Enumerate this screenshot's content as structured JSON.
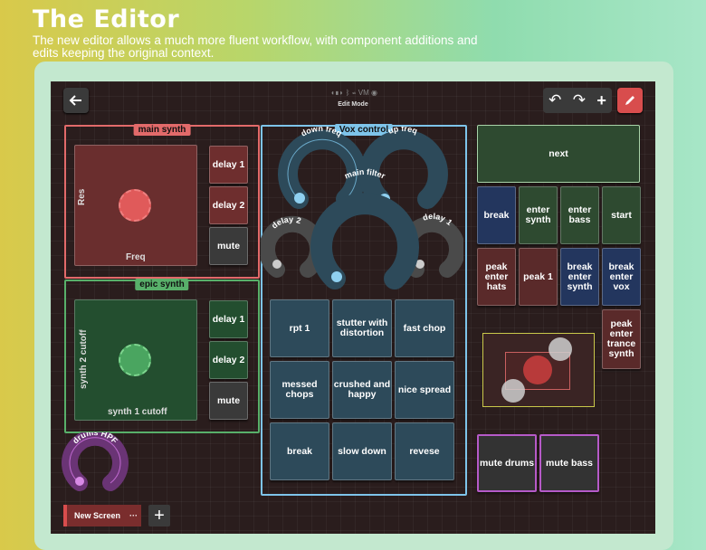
{
  "hero": {
    "title": "The Editor",
    "subtitle": "The new editor allows a much more fluent workflow, with component additions and edits keeping the original context."
  },
  "toolbar": {
    "back_icon": "arrow-left-icon",
    "status_icons": [
      "audio-icon",
      "bluetooth-icon",
      "usb-icon",
      "vm-icon",
      "settings-icon"
    ],
    "status_text": "VM",
    "mode_label": "Edit Mode",
    "undo_icon": "undo-icon",
    "redo_icon": "redo-icon",
    "add_icon": "plus-icon",
    "edit_icon": "pencil-icon"
  },
  "groups": {
    "main_synth": {
      "label": "main synth",
      "color": "#e26a6a",
      "xy": {
        "y_label": "Res",
        "x_label": "Freq"
      },
      "buttons": [
        "delay 1",
        "delay 2",
        "mute"
      ]
    },
    "epic_synth": {
      "label": "epic synth",
      "color": "#58b06a",
      "xy": {
        "y_label": "synth 2 cutoff",
        "x_label": "synth 1 cutoff"
      },
      "buttons": [
        "delay 1",
        "delay 2",
        "mute"
      ]
    },
    "vox_control": {
      "label": "Vox control",
      "color": "#7ec4ea",
      "knobs": {
        "down_freq": "down freq",
        "up_freq": "up freq",
        "main_filter": "main filter",
        "delay_2": "delay 2",
        "delay_1": "delay 1"
      },
      "pads": [
        "rpt 1",
        "stutter with distortion",
        "fast chop",
        "messed chops",
        "crushed and happy",
        "nice spread",
        "break",
        "slow down",
        "revese"
      ]
    }
  },
  "right": {
    "next": "next",
    "row1": [
      "break",
      "enter synth",
      "enter bass",
      "start"
    ],
    "row2": [
      "peak enter hats",
      "peak 1",
      "break enter synth",
      "break enter vox"
    ],
    "peak_trance": "peak enter trance synth",
    "mute_drums": "mute drums",
    "mute_bass": "mute bass"
  },
  "drums_knob": {
    "label": "drums HPF"
  },
  "bottom": {
    "new_screen": "New Screen",
    "more": "···",
    "add": "+"
  },
  "colors": {
    "accent_red": "#d84d4d",
    "vox_blue": "#7ec4ea",
    "green": "#58b06a",
    "purple": "#b65ac8",
    "yellow": "#c9c84a"
  }
}
